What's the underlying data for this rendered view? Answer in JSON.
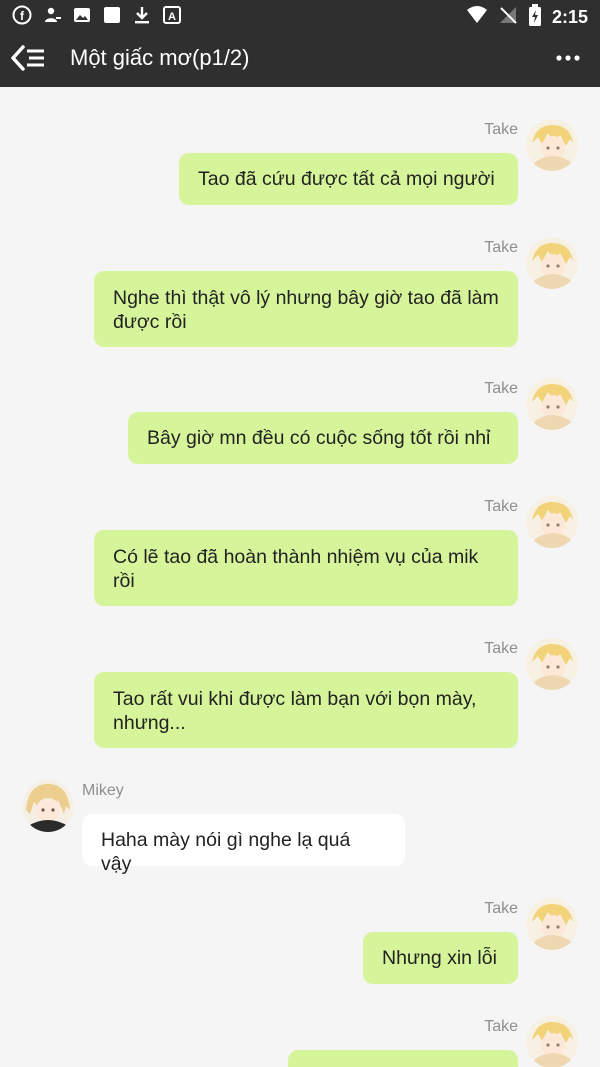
{
  "status": {
    "time": "2:15"
  },
  "header": {
    "title": "Một giấc mơ(p1/2)"
  },
  "messages": [
    {
      "sender": "Take",
      "text": "Tao đã cứu được tất cả mọi người"
    },
    {
      "sender": "Take",
      "text": "Nghe thì thật vô lý nhưng bây giờ tao đã làm được rồi"
    },
    {
      "sender": "Take",
      "text": "Bây giờ mn đều có cuộc sống tốt rồi nhỉ"
    },
    {
      "sender": "Take",
      "text": "Có lẽ tao đã hoàn thành nhiệm vụ của mik rồi"
    },
    {
      "sender": "Take",
      "text": "Tao rất vui khi được làm bạn với bọn mày, nhưng..."
    },
    {
      "sender": "Mikey",
      "text": "Haha mày nói gì nghe lạ quá vậy"
    },
    {
      "sender": "Take",
      "text": "Nhưng xin lỗi"
    },
    {
      "sender": "Take",
      "text": ""
    }
  ],
  "colors": {
    "header_bg": "#2f2f2f",
    "chat_bg": "#f5f5f5",
    "outgoing_bubble": "#d6f59a",
    "incoming_bubble": "#ffffff"
  },
  "icons": {
    "status_left": [
      "facebook-icon",
      "profile-icon",
      "image-icon",
      "square-icon",
      "download-icon",
      "a-icon"
    ],
    "status_right": [
      "wifi-icon",
      "no-signal-icon",
      "battery-icon"
    ]
  }
}
